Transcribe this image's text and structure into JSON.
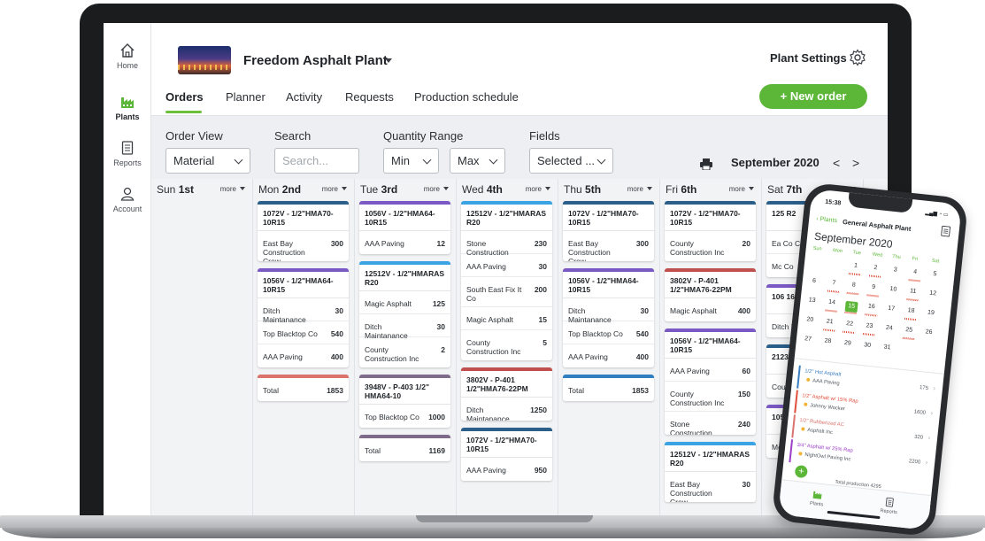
{
  "colors": {
    "accent": "#5cb738",
    "blue": "#2f7fc1",
    "purple": "#7b59c5",
    "salmon": "#d9736b",
    "navy": "#2b5f8a",
    "gray": "#7e6a8a"
  },
  "rail": {
    "items": [
      {
        "label": "Home",
        "icon": "home-icon"
      },
      {
        "label": "Plants",
        "icon": "factory-icon"
      },
      {
        "label": "Reports",
        "icon": "report-icon"
      },
      {
        "label": "Account",
        "icon": "user-icon"
      }
    ]
  },
  "header": {
    "plant_name": "Freedom Asphalt Plant",
    "settings_label": "Plant Settings",
    "new_order_label": "+ New order",
    "tabs": [
      "Orders",
      "Planner",
      "Activity",
      "Requests",
      "Production schedule"
    ]
  },
  "filters": {
    "order_view_label": "Order View",
    "order_view_value": "Material",
    "search_label": "Search",
    "search_placeholder": "Search...",
    "quantity_label": "Quantity Range",
    "min_value": "Min",
    "max_value": "Max",
    "fields_label": "Fields",
    "fields_value": "Selected ...",
    "month": "September 2020",
    "prev": "<",
    "next": ">"
  },
  "calendar": {
    "more_label": "more",
    "days": [
      {
        "wd": "Sun",
        "num": "1st",
        "cards": []
      },
      {
        "wd": "Mon",
        "num": "2nd",
        "cards": [
          {
            "color": "#2b5f8a",
            "title": "1072V - 1/2\"HMA70-10R15",
            "rows": [
              {
                "name": "East Bay Construction Crew",
                "qty": "300"
              }
            ]
          },
          {
            "color": "#7b59c5",
            "title": "1056V - 1/2\"HMA64-10R15",
            "rows": [
              {
                "name": "Ditch Maintanance",
                "qty": "30"
              },
              {
                "name": "Top Blacktop Co",
                "qty": "540"
              },
              {
                "name": "AAA Paving",
                "qty": "400"
              }
            ]
          },
          {
            "color": "#d9736b",
            "title": "",
            "rows": [
              {
                "name": "Total",
                "qty": "1853"
              }
            ]
          }
        ]
      },
      {
        "wd": "Tue",
        "num": "3rd",
        "cards": [
          {
            "color": "#7b59c5",
            "title": "1056V - 1/2\"HMA64-10R15",
            "rows": [
              {
                "name": "AAA Paving",
                "qty": "12"
              }
            ]
          },
          {
            "color": "#3aa3e3",
            "title": "12512V - 1/2\"HMARAS R20",
            "rows": [
              {
                "name": "Magic Asphalt",
                "qty": "125"
              },
              {
                "name": "Ditch Maintanance",
                "qty": "30"
              },
              {
                "name": "County Construction Inc",
                "qty": "2"
              }
            ]
          },
          {
            "color": "#7e6a8a",
            "title": "3948V - P-403 1/2\" HMA64-10",
            "rows": [
              {
                "name": "Top Blacktop Co",
                "qty": "1000"
              }
            ]
          },
          {
            "color": "#7e6a8a",
            "title": "",
            "rows": [
              {
                "name": "Total",
                "qty": "1169"
              }
            ]
          }
        ]
      },
      {
        "wd": "Wed",
        "num": "4th",
        "cards": [
          {
            "color": "#3aa3e3",
            "title": "12512V - 1/2\"HMARAS R20",
            "rows": [
              {
                "name": "Stone Construction",
                "qty": "230"
              },
              {
                "name": "AAA Paving",
                "qty": "30"
              },
              {
                "name": "South East Fix It Co",
                "qty": "200"
              },
              {
                "name": "Magic Asphalt",
                "qty": "15"
              },
              {
                "name": "County Construction Inc",
                "qty": "5"
              }
            ]
          },
          {
            "color": "#c0504d",
            "title": "3802V - P-401 1/2\"HMA76-22PM",
            "rows": [
              {
                "name": "Ditch Maintanance",
                "qty": "1250"
              }
            ]
          },
          {
            "color": "#2b5f8a",
            "title": "1072V - 1/2\"HMA70-10R15",
            "rows": [
              {
                "name": "AAA Paving",
                "qty": "950"
              }
            ]
          }
        ]
      },
      {
        "wd": "Thu",
        "num": "5th",
        "cards": [
          {
            "color": "#2b5f8a",
            "title": "1072V - 1/2\"HMA70-10R15",
            "rows": [
              {
                "name": "East Bay Construction Crew",
                "qty": "300"
              }
            ]
          },
          {
            "color": "#7b59c5",
            "title": "1056V - 1/2\"HMA64-10R15",
            "rows": [
              {
                "name": "Ditch Maintanance",
                "qty": "30"
              },
              {
                "name": "Top Blacktop Co",
                "qty": "540"
              },
              {
                "name": "AAA Paving",
                "qty": "400"
              }
            ]
          },
          {
            "color": "#2f7fc1",
            "title": "",
            "rows": [
              {
                "name": "Total",
                "qty": "1853"
              }
            ]
          }
        ]
      },
      {
        "wd": "Fri",
        "num": "6th",
        "cards": [
          {
            "color": "#2b5f8a",
            "title": "1072V - 1/2\"HMA70-10R15",
            "rows": [
              {
                "name": "County Construction Inc",
                "qty": "20"
              }
            ]
          },
          {
            "color": "#c0504d",
            "title": "3802V - P-401 1/2\"HMA76-22PM",
            "rows": [
              {
                "name": "Magic Asphalt",
                "qty": "400"
              }
            ]
          },
          {
            "color": "#7b59c5",
            "title": "1056V - 1/2\"HMA64-10R15",
            "rows": [
              {
                "name": "AAA Paving",
                "qty": "60"
              },
              {
                "name": "County Construction Inc",
                "qty": "150"
              },
              {
                "name": "Stone Construction",
                "qty": "240"
              }
            ]
          },
          {
            "color": "#3aa3e3",
            "title": "12512V - 1/2\"HMARAS R20",
            "rows": [
              {
                "name": "East Bay Construction Crew",
                "qty": "30"
              }
            ]
          }
        ]
      },
      {
        "wd": "Sat",
        "num": "7th",
        "cards": [
          {
            "color": "#2b5f8a",
            "title": "125 R2",
            "rows": [
              {
                "name": "Ea Co Cr",
                "qty": ""
              },
              {
                "name": "Mc Co",
                "qty": ""
              }
            ]
          },
          {
            "color": "#7b59c5",
            "title": "106 16R",
            "rows": [
              {
                "name": "Ditch Main",
                "qty": ""
              }
            ]
          },
          {
            "color": "#2b5f8a",
            "title": "2123 10R1",
            "rows": [
              {
                "name": "Count Constr",
                "qty": ""
              }
            ]
          },
          {
            "color": "#7b59c5",
            "title": "1056V 10R15",
            "rows": [
              {
                "name": "Mounta Consruc",
                "qty": ""
              }
            ]
          }
        ]
      }
    ]
  },
  "phone": {
    "time": "15:38",
    "back_label": "Plants",
    "plant_name": "General Asphalt Plant",
    "month": "September 2020",
    "weekdays": [
      "Sun",
      "Mon",
      "Tue",
      "Wed",
      "Thu",
      "Fri",
      "Sat"
    ],
    "weeks": [
      [
        "",
        "",
        "1",
        "2",
        "3",
        "4",
        "5"
      ],
      [
        "6",
        "7",
        "8",
        "9",
        "10",
        "11",
        "12"
      ],
      [
        "13",
        "14",
        "15",
        "16",
        "17",
        "18",
        "19"
      ],
      [
        "20",
        "21",
        "22",
        "23",
        "24",
        "25",
        "26"
      ],
      [
        "27",
        "28",
        "29",
        "30",
        "31",
        "",
        ""
      ]
    ],
    "selected_day": "15",
    "orders": [
      {
        "title": "1/2\" Hot Asphalt",
        "sub": "AAA Paving",
        "qty": "175",
        "color": "#3a7fc1"
      },
      {
        "title": "1/2\" Asphalt w/ 15% Rap",
        "sub": "Johnny Wocker",
        "qty": "1600",
        "color": "#e0503c"
      },
      {
        "title": "1/2\" Rubberized AC",
        "sub": "Asphalt Inc",
        "qty": "320",
        "color": "#d9736b"
      },
      {
        "title": "3/4\" Asphalt w/ 25% Rap",
        "sub": "NightOwl Paving Inc",
        "qty": "2200",
        "color": "#9b3fc8"
      }
    ],
    "total_label": "Total production",
    "total_value": "4295",
    "tab_plants": "Plants",
    "tab_reports": "Reports"
  }
}
